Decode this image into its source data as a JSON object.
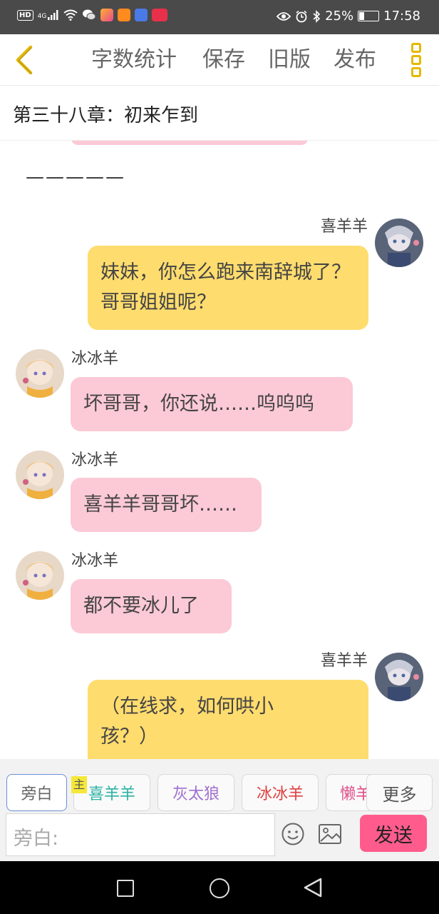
{
  "status_bar": {
    "network_badge": "HD",
    "signal_label": "4G",
    "battery_percent": "25%",
    "battery_level": 0.25,
    "time": "17:58",
    "icons": [
      "hd-icon",
      "signal-icon",
      "wifi-icon",
      "wechat-icon",
      "app-icon",
      "video-icon",
      "music-icon",
      "huawei-icon",
      "eye-icon",
      "alarm-icon",
      "bluetooth-icon",
      "battery-icon"
    ]
  },
  "toolbar": {
    "back_icon": "chevron-left-icon",
    "word_count": "字数统计",
    "save": "保存",
    "old_version": "旧版",
    "publish": "发布",
    "more_icon": "more-vertical-icon",
    "accent_color": "#e6b800"
  },
  "chapter": {
    "title": "第三十八章：初来乍到"
  },
  "chat": {
    "narration": "—————",
    "messages": [
      {
        "side": "right",
        "name": "喜羊羊",
        "text": "妹妹，你怎么跑来南辞城了？哥哥姐姐呢？",
        "color": "#ffdc6e"
      },
      {
        "side": "left",
        "name": "冰冰羊",
        "text": "坏哥哥，你还说……呜呜呜",
        "color": "#fcc9d6"
      },
      {
        "side": "left",
        "name": "冰冰羊",
        "text": "喜羊羊哥哥坏……",
        "color": "#fcc9d6"
      },
      {
        "side": "left",
        "name": "冰冰羊",
        "text": "都不要冰儿了",
        "color": "#fcc9d6"
      },
      {
        "side": "right",
        "name": "喜羊羊",
        "text": "（在线求，如何哄小孩？）",
        "color": "#ffdc6e"
      }
    ]
  },
  "roles": {
    "narrator": "旁白",
    "main_tag": "主",
    "items": [
      {
        "label": "喜羊羊",
        "color": "#2bb3a3"
      },
      {
        "label": "灰太狼",
        "color": "#a070d0"
      },
      {
        "label": "冰冰羊",
        "color": "#e04040"
      },
      {
        "label": "懒羊羊",
        "color": "#e0508a"
      }
    ],
    "more": "更多"
  },
  "input": {
    "placeholder": "旁白:",
    "emoji_icon": "emoji-icon",
    "image_icon": "image-icon",
    "send": "发送",
    "send_color": "#ff5c8d"
  },
  "nav": {
    "icons": [
      "recent-apps-icon",
      "home-icon",
      "back-icon"
    ]
  }
}
